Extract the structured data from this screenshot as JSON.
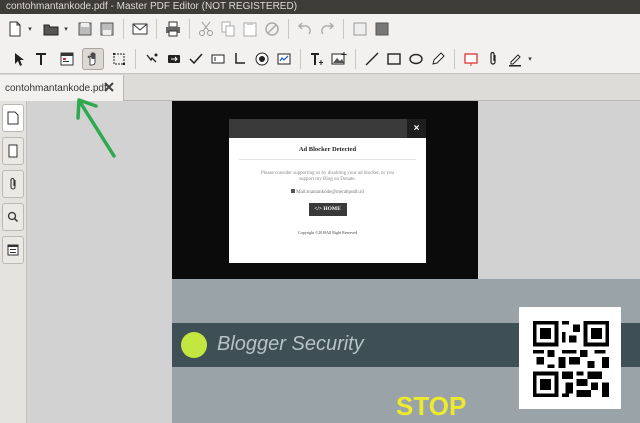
{
  "window": {
    "title": "contohmantankode.pdf - Master PDF Editor (NOT REGISTERED)"
  },
  "toolbar_row1": [
    "new-document-icon",
    "open-folder-icon",
    "save-icon",
    "save-as-icon",
    "email-icon",
    "print-icon",
    "cut-icon",
    "copy-icon",
    "paste-icon",
    "delete-icon",
    "undo-icon",
    "redo-icon",
    "window-icon",
    "black-square-icon"
  ],
  "toolbar_row2": [
    "select-arrow-icon",
    "text-select-icon",
    "form-icon",
    "hand-tool-icon",
    "crop-icon",
    "edit-object-icon",
    "tab-key-icon",
    "check-icon",
    "text-field-icon",
    "underline-text-icon",
    "radio-button-icon",
    "signature-icon",
    "add-text-icon",
    "add-image-icon",
    "line-icon",
    "rectangle-icon",
    "ellipse-icon",
    "pencil-icon",
    "stamp-icon",
    "attach-icon",
    "highlight-icon"
  ],
  "tab": {
    "label": "contohmantankode.pdf"
  },
  "sidebar": [
    "pages-icon",
    "bookmarks-icon",
    "attachments-icon",
    "search-icon",
    "layers-icon"
  ],
  "modal": {
    "title": "Ad Blocker Detected",
    "message": "Please consider supporting us by disabling your ad blocker, or you support my Blog on Donate.",
    "mail": "Mail:mantankode@merahputih.id",
    "button": "HOME",
    "copyright": "Copyright ©2018All Right Reserved",
    "close": "×"
  },
  "page": {
    "banner": "Blogger Security",
    "stop": "STOP"
  },
  "colors": {
    "titlebar": "#3d3c37",
    "banner": "#3e5055",
    "dot": "#c3e641",
    "stop": "#ecea2c",
    "annotation_arrow": "#2fa84f"
  }
}
